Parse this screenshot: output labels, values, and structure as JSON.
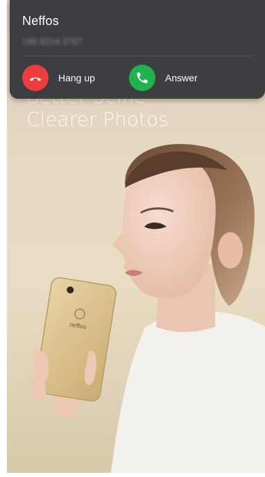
{
  "background": {
    "headline_line1": "Better Selfie",
    "headline_line2": "Clearer Photos",
    "phone_brand": "neffos"
  },
  "call": {
    "caller_name": "Neffos",
    "caller_number": "186 8214 3767",
    "hangup_label": "Hang up",
    "answer_label": "Answer",
    "hangup_icon": "phone-hangup-icon",
    "answer_icon": "phone-answer-icon",
    "hangup_color": "#ef3d3f",
    "answer_color": "#22b24c"
  }
}
